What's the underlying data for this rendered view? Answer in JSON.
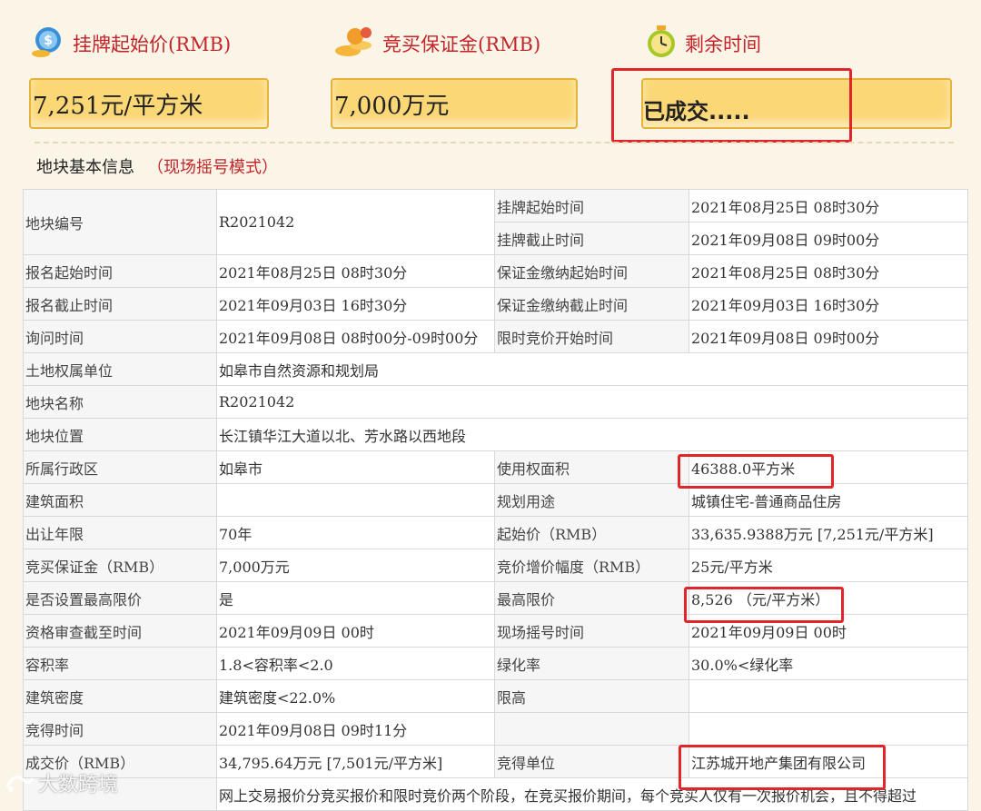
{
  "header": {
    "start_price_label": "挂牌起始价(RMB)",
    "deposit_label": "竞买保证金(RMB)",
    "remaining_time_label": "剩余时间"
  },
  "boxes": {
    "start_price": "7,251元/平方米",
    "deposit": "7,000万元",
    "status": "已成交....."
  },
  "icons": {
    "start_price": "money-icon",
    "deposit": "coins-icon",
    "remaining_time": "alarm-clock-icon"
  },
  "section": {
    "title": "地块基本信息",
    "mode": "（现场摇号模式）"
  },
  "table": {
    "r1": {
      "l1": "地块编号",
      "v1": "R2021042",
      "l2": "挂牌起始时间",
      "v2": "2021年08月25日 08时30分"
    },
    "r2": {
      "l2": "挂牌截止时间",
      "v2": "2021年09月08日 09时00分"
    },
    "r3": {
      "l1": "报名起始时间",
      "v1": "2021年08月25日 08时30分",
      "l2": "保证金缴纳起始时间",
      "v2": "2021年08月25日 08时30分"
    },
    "r4": {
      "l1": "报名截止时间",
      "v1": "2021年09月03日 16时30分",
      "l2": "保证金缴纳截止时间",
      "v2": "2021年09月03日 16时30分"
    },
    "r5": {
      "l1": "询问时间",
      "v1": "2021年09月08日 08时00分-09时00分",
      "l2": "限时竞价开始时间",
      "v2": "2021年09月08日 09时00分"
    },
    "r6": {
      "l1": "土地权属单位",
      "v1": "如皋市自然资源和规划局"
    },
    "r7": {
      "l1": "地块名称",
      "v1": "R2021042"
    },
    "r8": {
      "l1": "地块位置",
      "v1": "长江镇华江大道以北、芳水路以西地段"
    },
    "r9": {
      "l1": "所属行政区",
      "v1": "如皋市",
      "l2": "使用权面积",
      "v2": "46388.0平方米"
    },
    "r10": {
      "l1": "建筑面积",
      "v1": "",
      "l2": "规划用途",
      "v2": "城镇住宅-普通商品住房"
    },
    "r11": {
      "l1": "出让年限",
      "v1": "70年",
      "l2": "起始价（RMB）",
      "v2": "33,635.9388万元 [7,251元/平方米]"
    },
    "r12": {
      "l1": "竞买保证金（RMB）",
      "v1": "7,000万元",
      "l2": "竞价增价幅度（RMB）",
      "v2": "25元/平方米"
    },
    "r13": {
      "l1": "是否设置最高限价",
      "v1": "是",
      "l2": "最高限价",
      "v2": "8,526 （元/平方米）"
    },
    "r14": {
      "l1": "资格审查截至时间",
      "v1": "2021年09月09日 00时",
      "l2": "现场摇号时间",
      "v2": "2021年09月09日 00时"
    },
    "r15": {
      "l1": "容积率",
      "v1": "1.8<容积率<2.0",
      "l2": "绿化率",
      "v2": "30.0%<绿化率"
    },
    "r16": {
      "l1": "建筑密度",
      "v1": "建筑密度<22.0%",
      "l2": "限高",
      "v2": ""
    },
    "r17": {
      "l1": "竞得时间",
      "v1": "2021年09月08日 09时11分",
      "l2": "",
      "v2": ""
    },
    "r18": {
      "l1": "成交价（RMB）",
      "v1": "34,795.64万元 [7,501元/平方米]",
      "l2": "竞得单位",
      "v2": "江苏城开地产集团有限公司"
    },
    "r19": {
      "l1": "",
      "v1": "网上交易报价分竞买报价和限时竞价两个阶段，在竞买报价期间，每个竞买人仅有一次报价机会，且不得超过"
    }
  },
  "watermark": {
    "text": "大数跨境"
  },
  "colors": {
    "accent_red": "#c2242a",
    "highlight_frame": "#e0262b",
    "box_fill": "#fbd775"
  }
}
